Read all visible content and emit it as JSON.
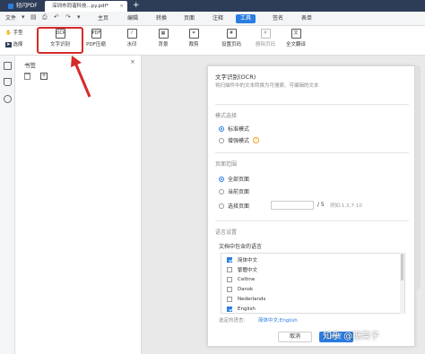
{
  "titlebar": {
    "app_name": "轻闪PDF",
    "doc_tab": "深圳市同谐科技...py.pdf*",
    "close_glyph": "×",
    "new_tab_glyph": "+"
  },
  "menubar": {
    "file_label": "文件",
    "items": [
      "主页",
      "编辑",
      "转换",
      "页面",
      "注释",
      "工具",
      "签名",
      "表单"
    ],
    "active": "工具"
  },
  "toolbar": {
    "hand_label": "手型",
    "select_label": "选择",
    "ocr_label": "文字识别",
    "pdf_ocr_label": "PDF压缩",
    "watermark_label": "水印",
    "background_label": "背景",
    "crop_label": "裁剪",
    "set_page_label": "设置页码",
    "delete_page_label": "删除页码",
    "translate_label": "全文翻译"
  },
  "bookmark": {
    "title": "书签",
    "close_glyph": "×"
  },
  "dialog": {
    "title": "文字识别(OCR)",
    "subtitle": "将扫描件中的文本转换为可搜索、可编辑的文本",
    "mode_section": "模式选择",
    "mode_standard": "标准模式",
    "mode_enhanced": "增强模式",
    "range_section": "页面范围",
    "range_all": "全部页面",
    "range_current": "当前页面",
    "range_select": "选择页面",
    "range_total": "/ 5",
    "range_example": "例如:1,3,7-10",
    "lang_section": "语言设置",
    "lang_prompt": "文档中包含的语言",
    "languages": [
      {
        "name": "简体中文",
        "checked": true
      },
      {
        "name": "繁體中文",
        "checked": false
      },
      {
        "name": "Celtine",
        "checked": false
      },
      {
        "name": "Dansk",
        "checked": false
      },
      {
        "name": "Nederlands",
        "checked": false
      },
      {
        "name": "English",
        "checked": true
      }
    ],
    "selected_label": "选定的语言:",
    "selected_value": "简体中文;English",
    "cancel_label": "取消",
    "ok_label": "确定"
  },
  "watermark": {
    "text": "知乎 @糖栗子"
  },
  "colors": {
    "accent": "#2a7de1",
    "highlight": "#d72a2a",
    "titlebar": "#2d3d57"
  }
}
